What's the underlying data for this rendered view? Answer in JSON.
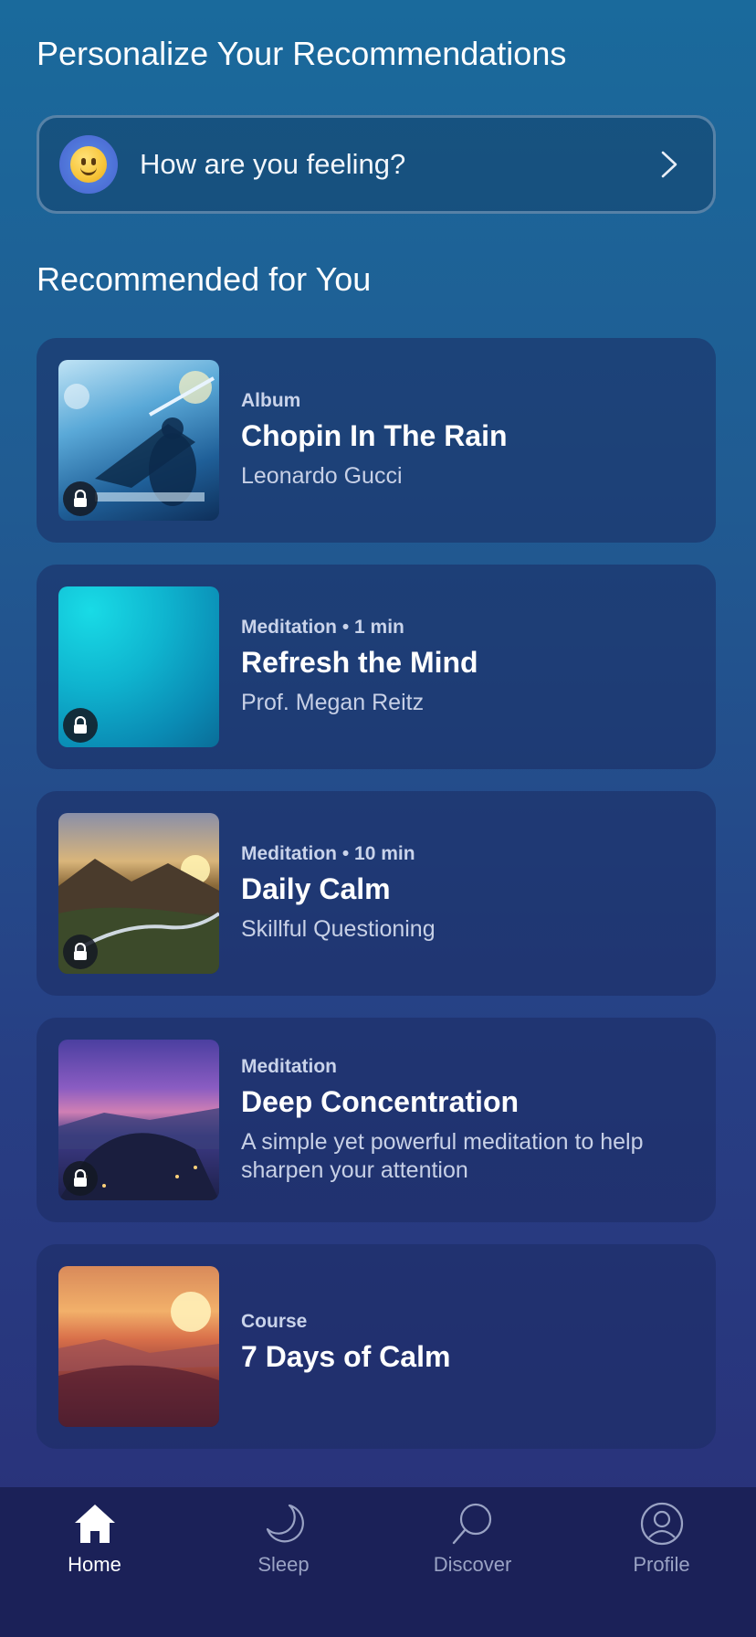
{
  "header": {
    "personalize_title": "Personalize Your Recommendations"
  },
  "feeling": {
    "label": "How are you feeling?",
    "icon": "smiley-face-icon"
  },
  "recommended": {
    "title": "Recommended for You",
    "items": [
      {
        "kind": "Album",
        "title": "Chopin In The Rain",
        "subtitle": "Leonardo Gucci",
        "locked": true
      },
      {
        "kind": "Meditation • 1 min",
        "title": "Refresh the Mind",
        "subtitle": "Prof. Megan Reitz",
        "locked": true
      },
      {
        "kind": "Meditation • 10 min",
        "title": "Daily Calm",
        "subtitle": "Skillful Questioning",
        "locked": true
      },
      {
        "kind": "Meditation",
        "title": "Deep Concentration",
        "subtitle": "A simple yet powerful meditation to help sharpen your attention",
        "locked": true
      },
      {
        "kind": "Course",
        "title": "7 Days of Calm",
        "subtitle": "",
        "locked": false
      }
    ]
  },
  "tabbar": {
    "tabs": [
      {
        "label": "Home",
        "icon": "home-icon",
        "active": true
      },
      {
        "label": "Sleep",
        "icon": "moon-icon",
        "active": false
      },
      {
        "label": "Discover",
        "icon": "search-icon",
        "active": false
      },
      {
        "label": "Profile",
        "icon": "profile-icon",
        "active": false
      }
    ]
  },
  "colors": {
    "active_tab": "#ffffff",
    "inactive_tab": "#9aa3c4",
    "tabbar_bg": "#1b2158"
  }
}
